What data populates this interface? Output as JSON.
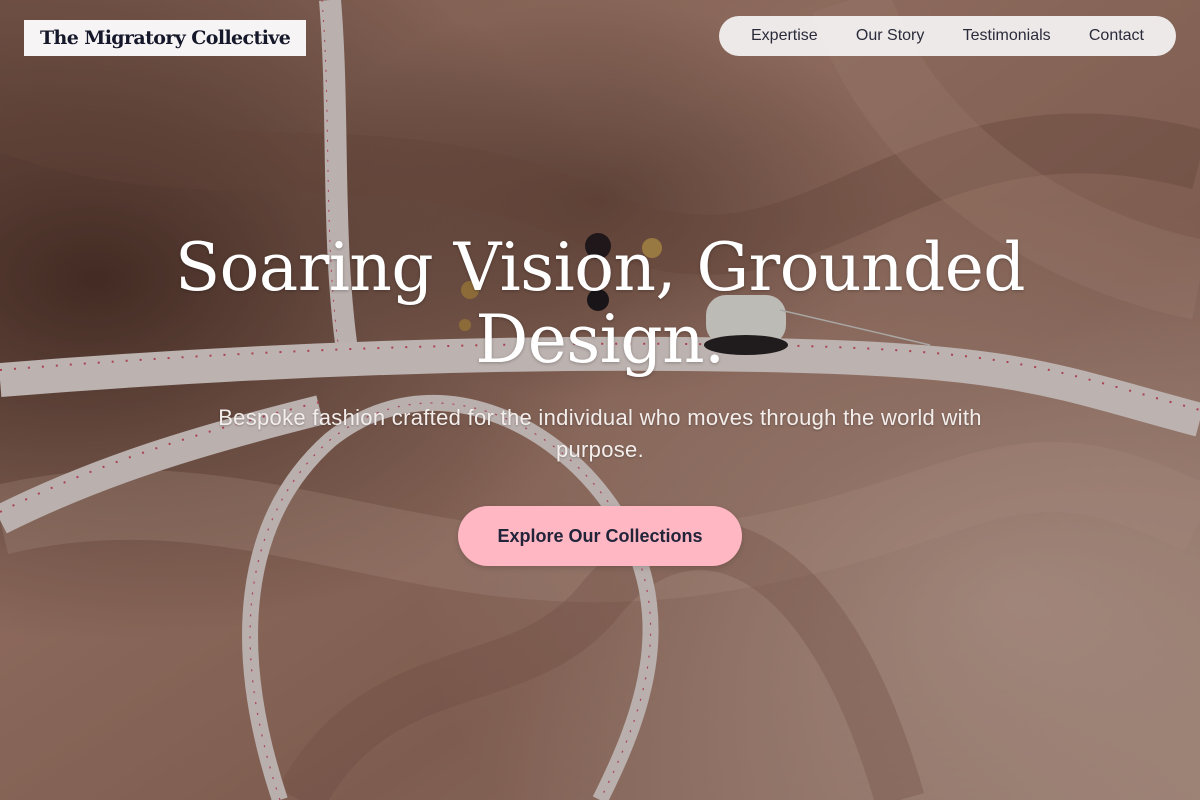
{
  "brand": {
    "name": "The Migratory Collective"
  },
  "nav": {
    "items": [
      "Expertise",
      "Our Story",
      "Testimonials",
      "Contact"
    ]
  },
  "hero": {
    "headline": "Soaring Vision, Grounded Design.",
    "subtitle": "Bespoke fashion crafted for the individual who moves through the world with purpose.",
    "cta_label": "Explore Our Collections",
    "background_image": "satin fabric with measuring tapes, buttons and thread spool"
  },
  "colors": {
    "cta_background": "#ffb7c3",
    "nav_background": "#f5f3f4",
    "text_dark": "#15172a",
    "hero_text": "#ffffff"
  }
}
